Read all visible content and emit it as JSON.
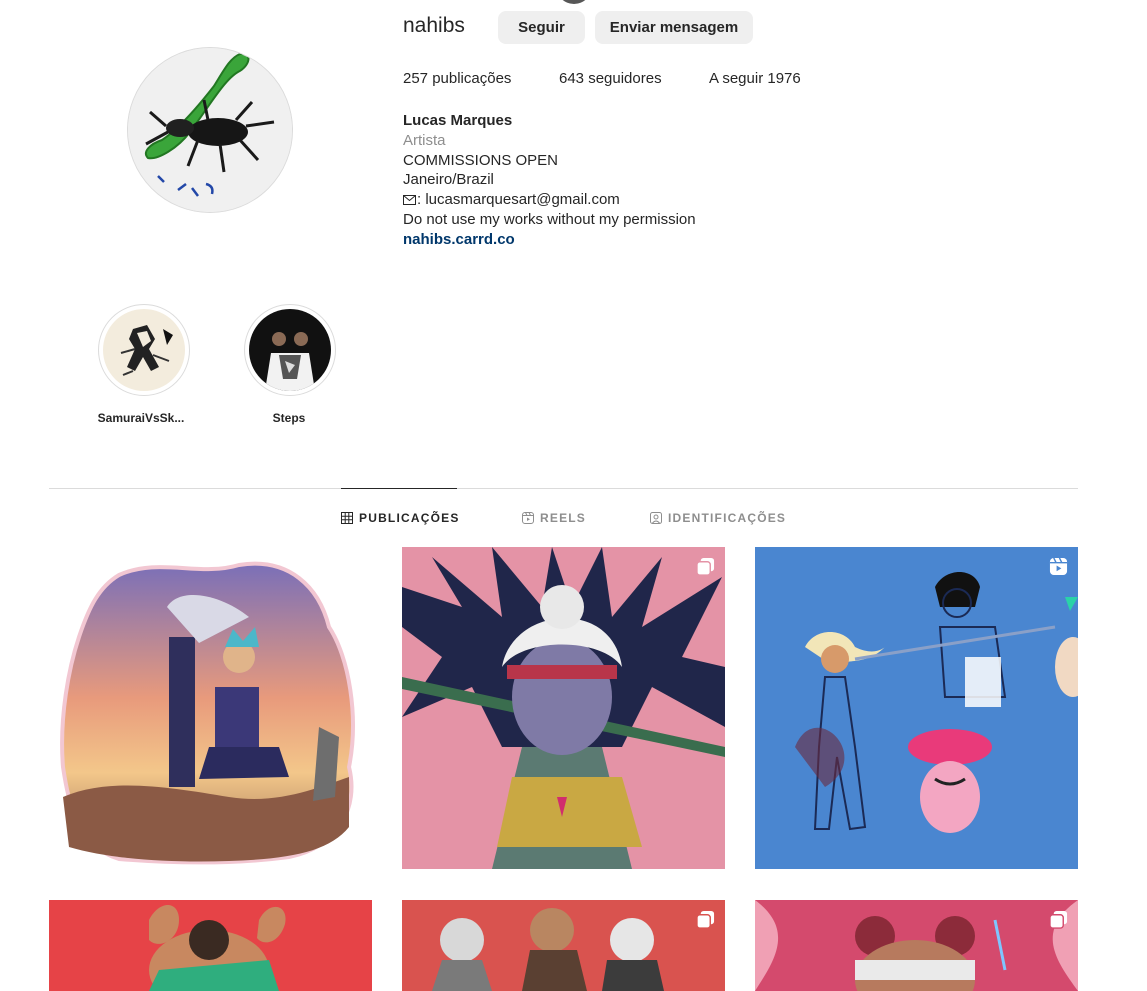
{
  "profile": {
    "username": "nahibs",
    "follow_label": "Seguir",
    "message_label": "Enviar mensagem",
    "stats": {
      "posts": "257 publicações",
      "followers": "643 seguidores",
      "following": "A seguir 1976"
    },
    "bio": {
      "name": "Lucas Marques",
      "category": "Artista",
      "line1": "COMMISSIONS OPEN",
      "line2": "Janeiro/Brazil",
      "email": ": lucasmarquesart@gmail.com",
      "line4": "Do not use my works without my permission",
      "link": "nahibs.carrd.co"
    }
  },
  "highlights": [
    {
      "label": "SamuraiVsSk..."
    },
    {
      "label": "Steps"
    }
  ],
  "tabs": [
    {
      "label": "PUBLICAÇÕES",
      "icon": "grid-icon",
      "active": true
    },
    {
      "label": "REELS",
      "icon": "reels-icon",
      "active": false
    },
    {
      "label": "IDENTIFICAÇÕES",
      "icon": "tagged-icon",
      "active": false
    }
  ],
  "posts": [
    {
      "type": "image",
      "bg": "#ffffff"
    },
    {
      "type": "carousel",
      "bg": "#e493a6"
    },
    {
      "type": "reel",
      "bg": "#4a86d0"
    },
    {
      "type": "image",
      "bg": "#e64347"
    },
    {
      "type": "carousel",
      "bg": "#d9534f"
    },
    {
      "type": "carousel",
      "bg": "#d44a6d"
    }
  ],
  "colors": {
    "text": "#262626",
    "muted": "#8e8e8e",
    "link": "#00376b",
    "button_bg": "#efefef",
    "border": "#dbdbdb"
  }
}
